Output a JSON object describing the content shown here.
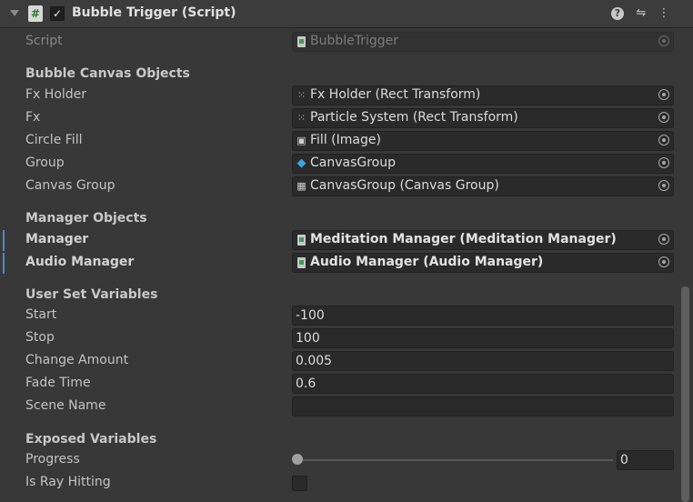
{
  "component": {
    "icon_text": "#",
    "check": "✓",
    "title": "Bubble Trigger (Script)"
  },
  "script": {
    "label": "Script",
    "value": "BubbleTrigger"
  },
  "sections": {
    "bubble_canvas": "Bubble Canvas Objects",
    "manager": "Manager Objects",
    "user_vars": "User Set Variables",
    "exposed": "Exposed Variables"
  },
  "bubble_fields": [
    {
      "label": "Fx Holder",
      "value": "Fx Holder (Rect Transform)",
      "icon": "rect-transform-icon"
    },
    {
      "label": "Fx",
      "value": "Particle System (Rect Transform)",
      "icon": "rect-transform-icon"
    },
    {
      "label": "Circle Fill",
      "value": "Fill (Image)",
      "icon": "image-icon"
    },
    {
      "label": "Group",
      "value": "CanvasGroup",
      "icon": "gameobject-cube-icon"
    },
    {
      "label": "Canvas Group",
      "value": "CanvasGroup (Canvas Group)",
      "icon": "canvas-group-icon"
    }
  ],
  "manager_fields": [
    {
      "label": "Manager",
      "value": "Meditation Manager (Meditation Manager)"
    },
    {
      "label": "Audio Manager",
      "value": "Audio Manager (Audio Manager)"
    }
  ],
  "user_fields": [
    {
      "label": "Start",
      "value": "-100"
    },
    {
      "label": "Stop",
      "value": "100"
    },
    {
      "label": "Change Amount",
      "value": "0.005"
    },
    {
      "label": "Fade Time",
      "value": "0.6"
    },
    {
      "label": "Scene Name",
      "value": ""
    }
  ],
  "exposed_fields": {
    "progress_label": "Progress",
    "progress_value": "0",
    "ray_label": "Is Ray Hitting",
    "ray_checked": false
  }
}
